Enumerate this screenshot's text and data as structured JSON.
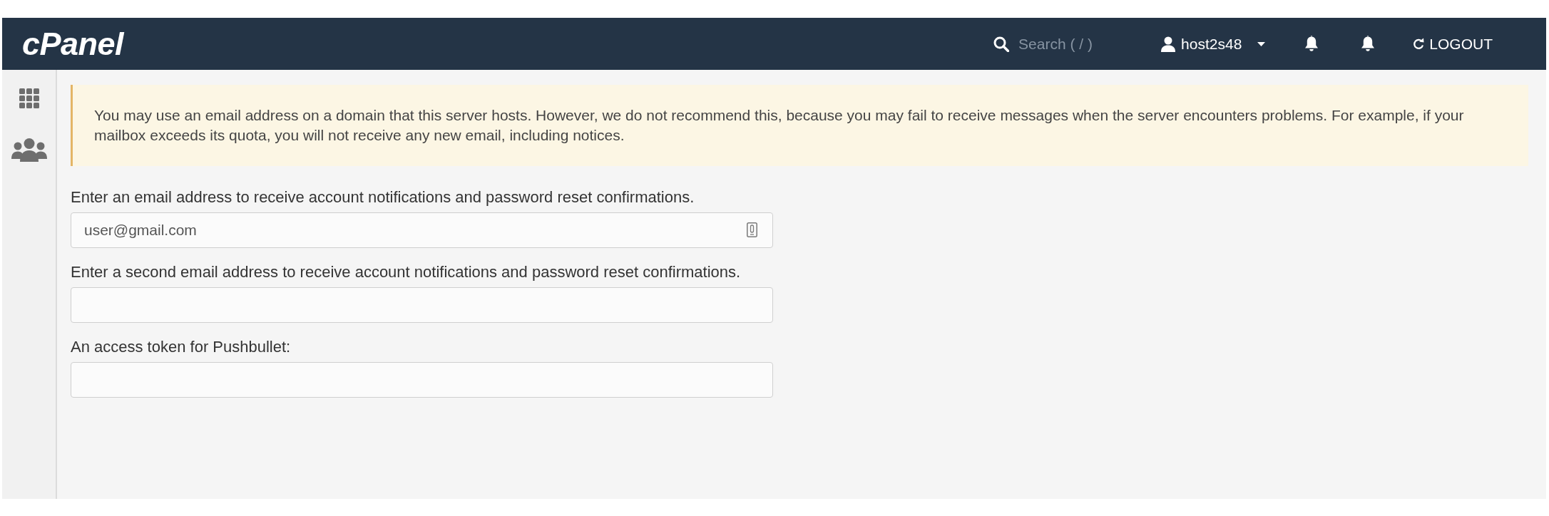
{
  "header": {
    "logo": "cPanel",
    "search": {
      "placeholder": "Search ( / )"
    },
    "user_menu": {
      "label": "host2s48"
    },
    "logout": {
      "label": "LOGOUT"
    }
  },
  "alert": {
    "text": "You may use an email address on a domain that this server hosts. However, we do not recommend this, because you may fail to receive messages when the server encounters problems. For example, if your mailbox exceeds its quota, you will not receive any new email, including notices."
  },
  "form": {
    "fields": [
      {
        "label": "Enter an email address to receive account notifications and password reset confirmations.",
        "value": "user@gmail.com",
        "autofill_icon": true
      },
      {
        "label": "Enter a second email address to receive account notifications and password reset confirmations.",
        "autofill_icon": false
      },
      {
        "label": "An access token for Pushbullet:",
        "autofill_icon": false
      }
    ]
  }
}
